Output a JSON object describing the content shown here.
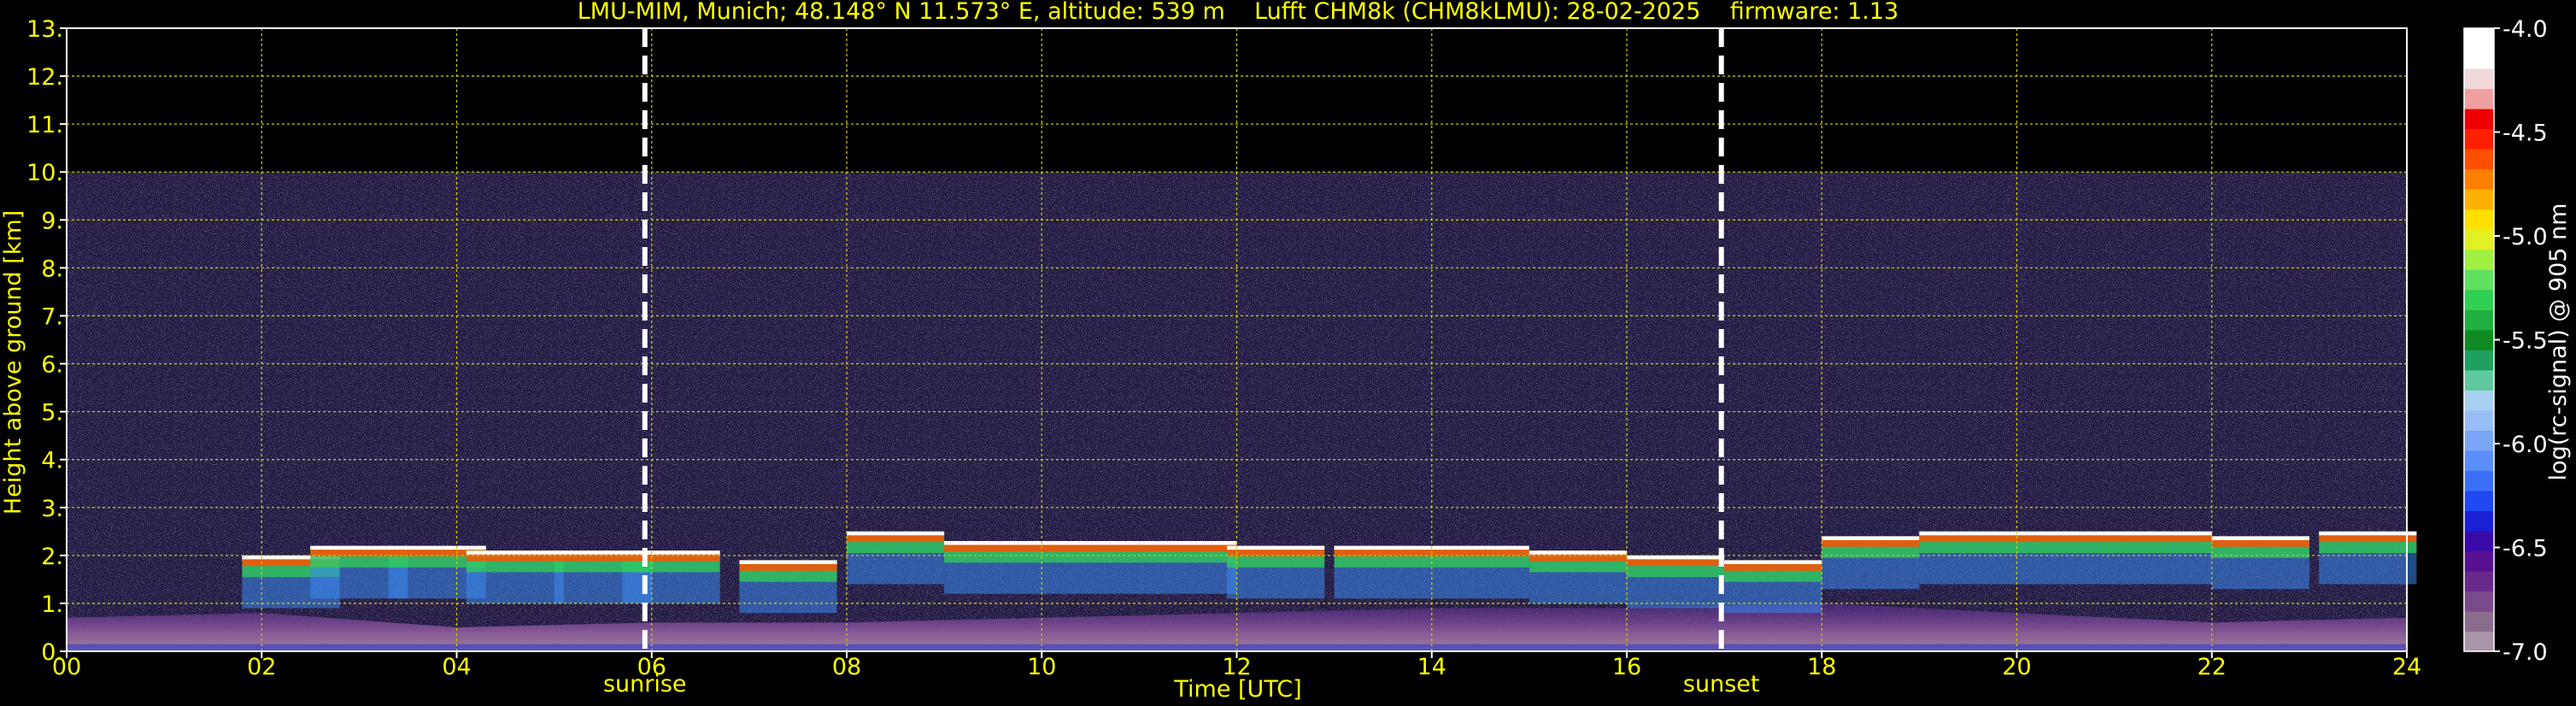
{
  "chart_data": {
    "type": "heatmap",
    "title": "LMU-MIM, Munich; 48.148° N 11.573° E, altitude: 539 m    Lufft CHM8k (CHM8kLMU): 28-02-2025    firmware: 1.13",
    "xlabel": "Time [UTC]",
    "ylabel": "Height above ground [km]",
    "xlim": [
      0,
      24
    ],
    "ylim": [
      0,
      13
    ],
    "x_ticks": [
      "00",
      "02",
      "04",
      "06",
      "08",
      "10",
      "12",
      "14",
      "16",
      "18",
      "20",
      "22",
      "24"
    ],
    "y_ticks": [
      "0.",
      "1.",
      "2.",
      "3.",
      "4.",
      "5.",
      "6.",
      "7.",
      "8.",
      "9.",
      "10.",
      "11.",
      "12.",
      "13."
    ],
    "grid": true,
    "data_top_km": 10,
    "annotations": [
      {
        "label": "sunrise",
        "time_h": 5.93
      },
      {
        "label": "sunset",
        "time_h": 16.97
      }
    ],
    "colorbar": {
      "label": "log(rc-signal) @ 905 nm",
      "range": [
        -7.0,
        -4.0
      ],
      "ticks": [
        "-4.0",
        "-4.5",
        "-5.0",
        "-5.5",
        "-6.0",
        "-6.5",
        "-7.0"
      ],
      "colors": [
        "#a896a8",
        "#8c6c8c",
        "#7a4a8a",
        "#682a8a",
        "#57108f",
        "#3a0aa8",
        "#1a20d8",
        "#1f48f0",
        "#3a70f8",
        "#5a8ef8",
        "#7aa6f8",
        "#98bef8",
        "#a8d0f0",
        "#60c8a0",
        "#20a060",
        "#108a20",
        "#20b040",
        "#30d050",
        "#60e060",
        "#a0f040",
        "#e0f020",
        "#ffe000",
        "#ffb000",
        "#ff8000",
        "#ff5000",
        "#ff2000",
        "#ee0000",
        "#f0a0a0",
        "#f0d8d8",
        "#ffffff",
        "#ffffff"
      ]
    },
    "series": [
      {
        "name": "cloud base",
        "x": [
          2.3,
          3.0,
          3.8,
          4.6,
          5.5,
          6.2,
          7.4,
          8.5,
          9.5,
          10.5,
          11.5,
          12.4,
          13.5,
          14.5,
          15.5,
          16.5,
          17.5,
          18.5,
          19.5,
          20.5,
          21.5,
          22.5,
          23.6
        ],
        "y": [
          2.0,
          2.2,
          2.2,
          2.1,
          2.1,
          2.1,
          1.9,
          2.5,
          2.3,
          2.3,
          2.3,
          2.2,
          2.2,
          2.2,
          2.1,
          2.0,
          1.9,
          2.4,
          2.5,
          2.5,
          2.5,
          2.4,
          2.5
        ]
      },
      {
        "name": "boundary layer top",
        "x": [
          0,
          2,
          4,
          6,
          8,
          10,
          12,
          14,
          16,
          18,
          20,
          22,
          24
        ],
        "y": [
          0.7,
          0.8,
          0.5,
          0.6,
          0.6,
          0.7,
          0.8,
          0.9,
          0.9,
          1.0,
          0.8,
          0.6,
          0.7
        ]
      }
    ]
  }
}
